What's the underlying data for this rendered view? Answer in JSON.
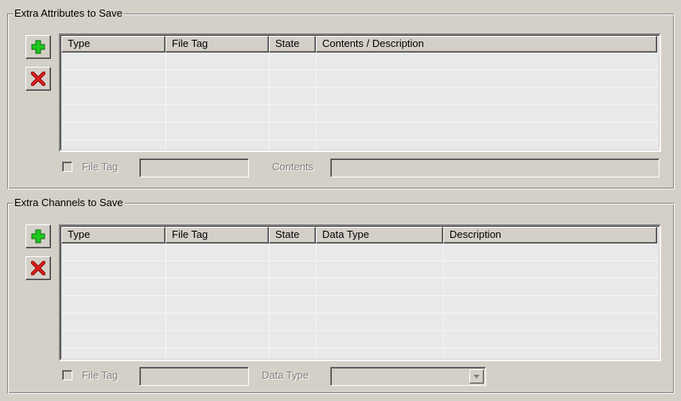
{
  "attributes_group": {
    "title": "Extra Attributes to Save",
    "columns": [
      "Type",
      "File Tag",
      "State",
      "Contents / Description"
    ],
    "rows": [],
    "file_tag_label": "File Tag",
    "file_tag_value": "",
    "file_tag_checked": false,
    "contents_label": "Contents",
    "contents_value": ""
  },
  "channels_group": {
    "title": "Extra Channels to Save",
    "columns": [
      "Type",
      "File Tag",
      "State",
      "Data Type",
      "Description"
    ],
    "rows": [],
    "file_tag_label": "File Tag",
    "file_tag_value": "",
    "file_tag_checked": false,
    "data_type_label": "Data Type",
    "data_type_value": ""
  },
  "icons": {
    "add": "plus-icon",
    "delete": "x-icon",
    "dropdown": "chevron-down-icon",
    "add_color": "#1fc91f",
    "delete_color": "#e02020"
  }
}
